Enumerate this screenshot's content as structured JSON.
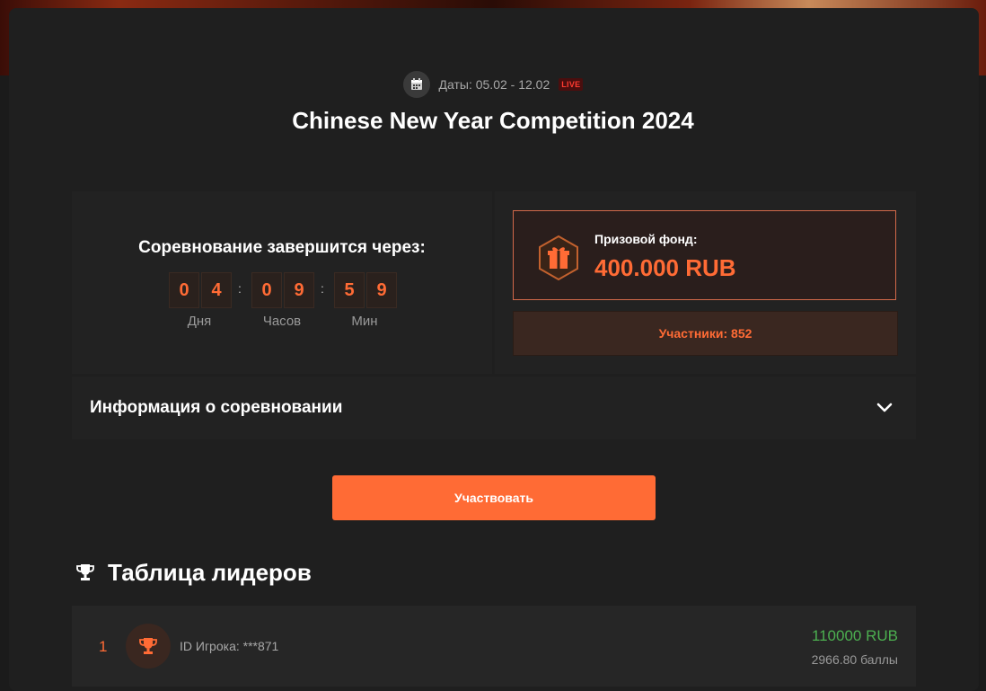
{
  "header": {
    "dates_label": "Даты: 05.02 - 12.02",
    "live_badge": "LIVE",
    "title": "Chinese New Year Competition 2024"
  },
  "timer": {
    "label": "Соревнование завершится через:",
    "days": [
      "0",
      "4"
    ],
    "hours": [
      "0",
      "9"
    ],
    "minutes": [
      "5",
      "9"
    ],
    "units": {
      "days": "Дня",
      "hours": "Часов",
      "minutes": "Мин"
    },
    "separator": ":"
  },
  "prize": {
    "label": "Призовой фонд:",
    "value": "400.000 RUB",
    "icon": "gift-icon"
  },
  "participants": {
    "label": "Участники: 852"
  },
  "info": {
    "title": "Информация о соревновании",
    "icon": "chevron-down-icon"
  },
  "join_button": {
    "label": "Участвовать"
  },
  "leaderboard": {
    "title": "Таблица лидеров",
    "rows": [
      {
        "rank": "1",
        "player": "ID Игрока: ***871",
        "prize": "110000 RUB",
        "points": "2966.80 баллы"
      }
    ]
  },
  "colors": {
    "accent": "#ff6b35",
    "prize_green": "#4caf50",
    "live_red": "#ff3b30",
    "background": "#1b1b1b"
  }
}
